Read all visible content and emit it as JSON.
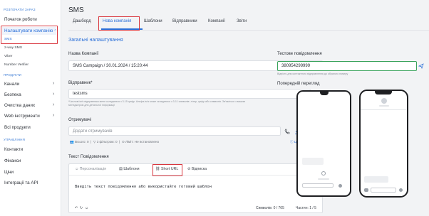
{
  "sidebar": {
    "sections": {
      "getting_started": "РОЗПОЧАТИ ЗАРАЗ",
      "products": "ПРОДУКТИ",
      "management": "УПРАВЛІННЯ"
    },
    "items": {
      "start": "Початок роботи",
      "configure": "Налаштувати компанію",
      "sms": "SMS",
      "two_way": "2-way SMS",
      "viber": "Viber",
      "number_verifier": "Number Verifier",
      "channels": "Канали",
      "security": "Безпека",
      "cleaning": "Очистка даних",
      "web_tools": "Web інструменти",
      "all_products": "Всі продукти",
      "contacts": "Контакти",
      "finance": "Фінанси",
      "prices": "Ціни",
      "integration": "Інтеграції та API"
    }
  },
  "main": {
    "title": "SMS",
    "tabs": [
      "Дашборд",
      "Нова компанія",
      "Шаблони",
      "Відправники",
      "Компанії",
      "Звіти"
    ],
    "active_tab": "Нова компанія",
    "section_title": "Загальні налаштування",
    "campaign_name_label": "Назва Компанії",
    "campaign_name_value": "SMS Campaign / 30.01.2024 / 15:20:44",
    "sender_label": "Відправник*",
    "sender_value": "testsms",
    "sender_hint": "*Числові ім'я відправника мене складатися з 3-15 цифр. Альфа-ім'я може складатися з 3-11 символів: літер, цифр або символів. Зв'яжіться з вашим менеджером для детальної інформації",
    "recipients_label": "Отримувачі",
    "recipients_placeholder": "Додати отримувачів",
    "recipients_total": "Всього: 0",
    "recipients_filtered": "3 фільтром: 0",
    "recipients_limit": "Ліміт: Не встановлено",
    "help_link": "Це працює",
    "message_label": "Текст Повідомлення",
    "toolbar": {
      "personalize": "Персоналізація",
      "templates": "Шаблони",
      "short_url": "Short URL",
      "reply": "Відписка"
    },
    "message_placeholder": "Введіть текст повідомлення або використайте готовий шаблон",
    "symbols": "Символів: 0 / 765",
    "parts": "Частин: 1 / 5",
    "test_label": "Тестове повідомлення",
    "test_value": "380954299999",
    "test_hint": "Відпість для контактного відправлення до обраного номеру",
    "preview_label": "Попередній перегляд"
  },
  "colors": {
    "accent": "#2a6fd8",
    "highlight": "#d9363e",
    "test_border": "#3aa35c"
  }
}
